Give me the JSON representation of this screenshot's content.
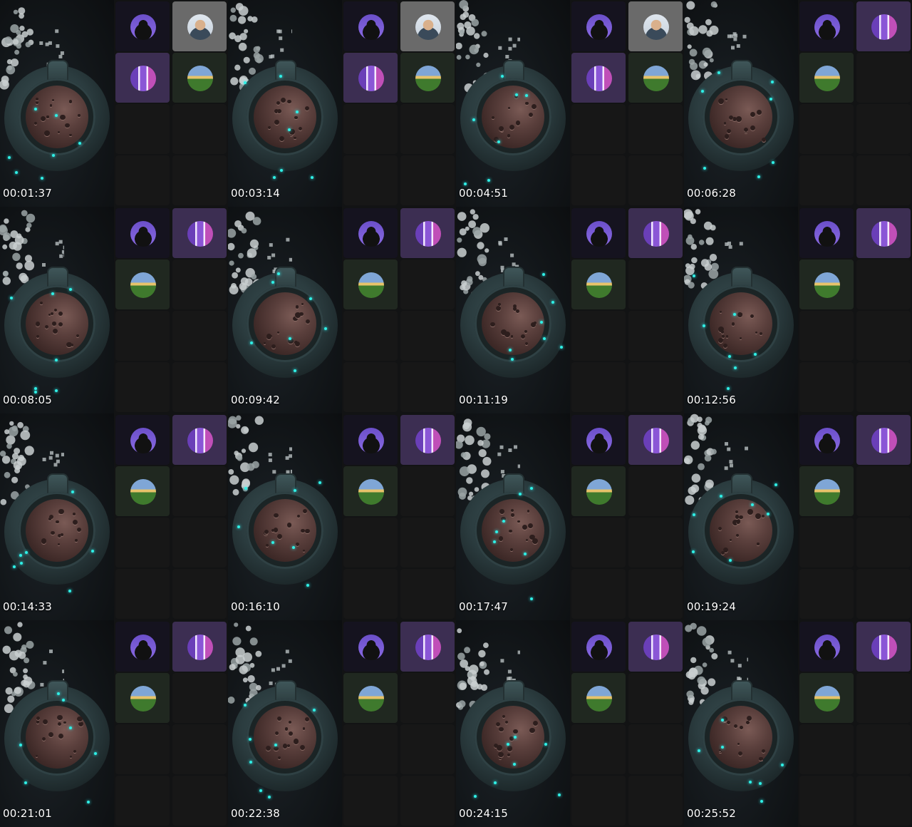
{
  "sheet": {
    "frames": [
      {
        "timestamp": "00:01:37",
        "tiles": [
          "cat",
          "person",
          "stripes",
          "field",
          "empty",
          "empty",
          "empty",
          "empty"
        ]
      },
      {
        "timestamp": "00:03:14",
        "tiles": [
          "cat",
          "person",
          "stripes",
          "field",
          "empty",
          "empty",
          "empty",
          "empty"
        ]
      },
      {
        "timestamp": "00:04:51",
        "tiles": [
          "cat",
          "person",
          "stripes",
          "field",
          "empty",
          "empty",
          "empty",
          "empty"
        ]
      },
      {
        "timestamp": "00:06:28",
        "tiles": [
          "cat",
          "stripes",
          "field",
          "empty",
          "empty",
          "empty",
          "empty",
          "empty"
        ]
      },
      {
        "timestamp": "00:08:05",
        "tiles": [
          "cat",
          "stripes",
          "field",
          "empty",
          "empty",
          "empty",
          "empty",
          "empty"
        ]
      },
      {
        "timestamp": "00:09:42",
        "tiles": [
          "cat",
          "stripes",
          "field",
          "empty",
          "empty",
          "empty",
          "empty",
          "empty"
        ]
      },
      {
        "timestamp": "00:11:19",
        "tiles": [
          "cat",
          "stripes",
          "field",
          "empty",
          "empty",
          "empty",
          "empty",
          "empty"
        ]
      },
      {
        "timestamp": "00:12:56",
        "tiles": [
          "cat",
          "stripes",
          "field",
          "empty",
          "empty",
          "empty",
          "empty",
          "empty"
        ]
      },
      {
        "timestamp": "00:14:33",
        "tiles": [
          "cat",
          "stripes",
          "field",
          "empty",
          "empty",
          "empty",
          "empty",
          "empty"
        ]
      },
      {
        "timestamp": "00:16:10",
        "tiles": [
          "cat",
          "stripes",
          "field",
          "empty",
          "empty",
          "empty",
          "empty",
          "empty"
        ]
      },
      {
        "timestamp": "00:17:47",
        "tiles": [
          "cat",
          "stripes",
          "field",
          "empty",
          "empty",
          "empty",
          "empty",
          "empty"
        ]
      },
      {
        "timestamp": "00:19:24",
        "tiles": [
          "cat",
          "stripes",
          "field",
          "empty",
          "empty",
          "empty",
          "empty",
          "empty"
        ]
      },
      {
        "timestamp": "00:21:01",
        "tiles": [
          "cat",
          "stripes",
          "field",
          "empty",
          "empty",
          "empty",
          "empty",
          "empty"
        ]
      },
      {
        "timestamp": "00:22:38",
        "tiles": [
          "cat",
          "stripes",
          "field",
          "empty",
          "empty",
          "empty",
          "empty",
          "empty"
        ]
      },
      {
        "timestamp": "00:24:15",
        "tiles": [
          "cat",
          "stripes",
          "field",
          "empty",
          "empty",
          "empty",
          "empty",
          "empty"
        ]
      },
      {
        "timestamp": "00:25:52",
        "tiles": [
          "cat",
          "stripes",
          "field",
          "empty",
          "empty",
          "empty",
          "empty",
          "empty"
        ]
      }
    ]
  },
  "avatar_icons": {
    "cat": "cat-silhouette-avatar-icon",
    "person": "person-photo-avatar-icon",
    "stripes": "purple-stripes-avatar-icon",
    "field": "landscape-field-avatar-icon"
  },
  "colors": {
    "background": "#0a0a0a",
    "tile": "#171717",
    "spark": "#2ff0e6",
    "timestamp": "#ffffff"
  }
}
